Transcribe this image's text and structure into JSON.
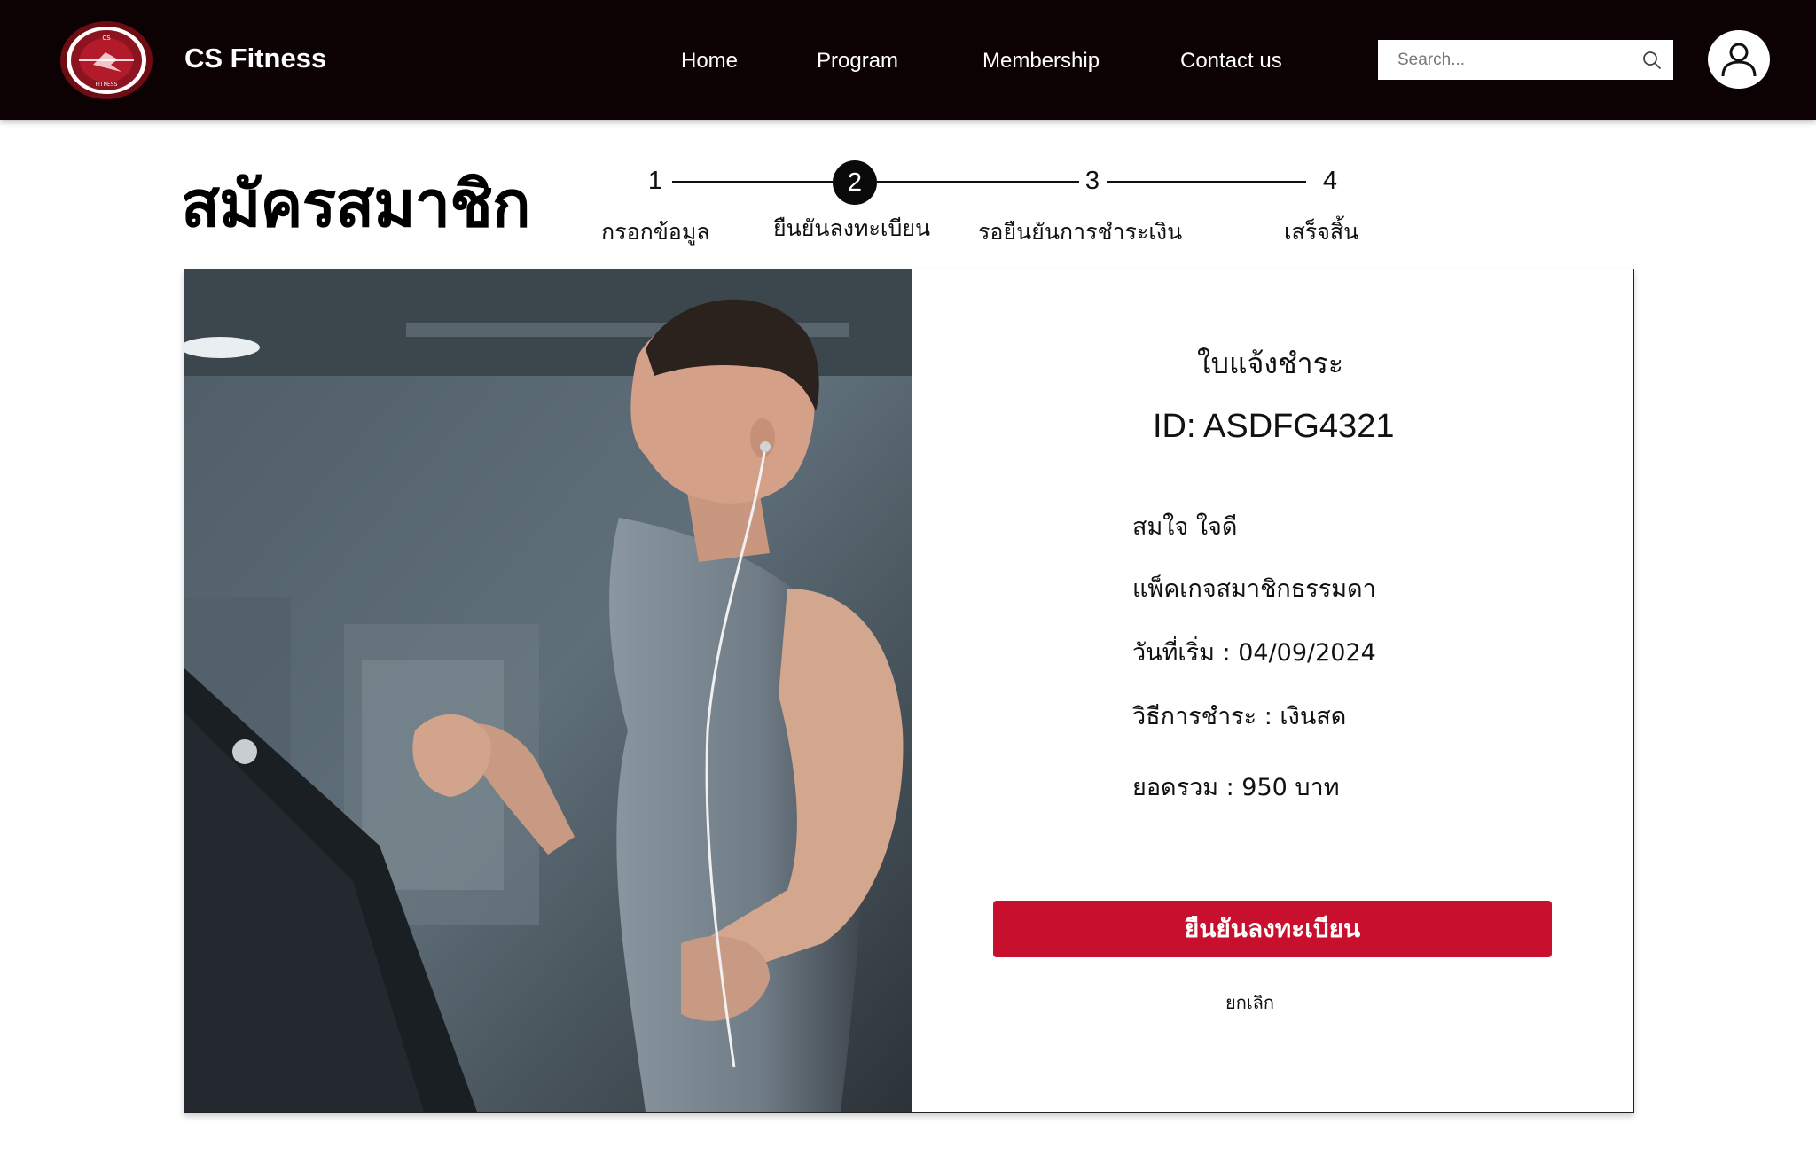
{
  "header": {
    "brand": "CS Fitness",
    "logo_icon": "cs-fitness-logo",
    "nav": [
      {
        "label": "Home"
      },
      {
        "label": "Program"
      },
      {
        "label": "Membership"
      },
      {
        "label": "Contact us"
      }
    ],
    "search": {
      "placeholder": "Search...",
      "icon": "search-icon"
    },
    "user_icon": "user-icon"
  },
  "page": {
    "title": "สมัครสมาชิก"
  },
  "stepper": {
    "current": 2,
    "steps": [
      {
        "number": "1",
        "label": "กรอกข้อมูล"
      },
      {
        "number": "2",
        "label": "ยืนยันลงทะเบียน"
      },
      {
        "number": "3",
        "label": "รอยืนยันการชำระเงิน"
      },
      {
        "number": "4",
        "label": "เสร็จสิ้น"
      }
    ]
  },
  "invoice": {
    "title": "ใบแจ้งชำระ",
    "id": "ID: ASDFG4321",
    "name": "สมใจ ใจดี",
    "package": "แพ็คเกจสมาชิกธรรมดา",
    "start_date": "วันที่เริ่ม : 04/09/2024",
    "payment_method": "วิธีการชำระ : เงินสด",
    "total": "ยอดรวม : 950 บาท"
  },
  "actions": {
    "confirm_label": "ยืนยันลงทะเบียน",
    "cancel_label": "ยกเลิก"
  },
  "colors": {
    "header_bg": "#0d0203",
    "accent": "#c8102e",
    "logo_ring": "#7a0f18"
  }
}
